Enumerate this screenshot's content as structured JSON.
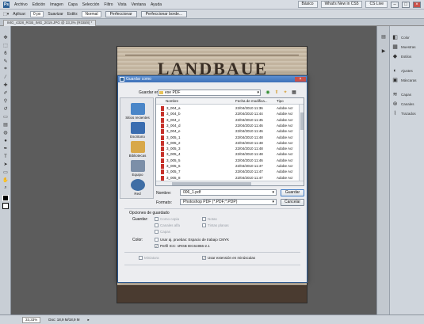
{
  "menubar": {
    "logo": "Ps",
    "items": [
      "Archivo",
      "Edición",
      "Imagen",
      "Capa",
      "Selección",
      "Filtro",
      "Vista",
      "Ventana",
      "Ayuda"
    ],
    "right": {
      "workspace": "Básico",
      "whats_new": "What's New in CS5",
      "cslive": "CS Live"
    }
  },
  "options": {
    "feather_label": "Aplicar:",
    "feather_value": "0 px",
    "antialias_label": "Suavizar",
    "style_label": "Estilo:",
    "style_value": "Normal",
    "refine_label": "Perfeccionar",
    "refine_button": "Perfeccionar borde..."
  },
  "document": {
    "tab_label": "IMG_4328_RGB_IMG_2019.JPG @ 33,3% (RGB/8) *",
    "image_heading": "LANDBAUE"
  },
  "dialog": {
    "title": "Guardar como",
    "save_in_label": "Guardar en:",
    "save_in_value": "ese PDF",
    "places": [
      {
        "label": "Sitios recientes",
        "color": "#4a86c8"
      },
      {
        "label": "Escritorio",
        "color": "#3a6db0"
      },
      {
        "label": "Bibliotecas",
        "color": "#d8a84a"
      },
      {
        "label": "Equipo",
        "color": "#7c8fa8"
      },
      {
        "label": "Red",
        "color": "#3f6ea5"
      }
    ],
    "columns": {
      "name": "Nombre",
      "date": "Fecha de modifica...",
      "type": "Tipo"
    },
    "files": [
      {
        "name": "3_004_a",
        "date": "22/04/2010 11:36",
        "type": "Adobe Acr"
      },
      {
        "name": "3_004_b",
        "date": "22/04/2010 11:44",
        "type": "Adobe Acr"
      },
      {
        "name": "3_004_c",
        "date": "22/04/2010 11:45",
        "type": "Adobe Acr"
      },
      {
        "name": "3_004_d",
        "date": "22/04/2010 11:46",
        "type": "Adobe Acr"
      },
      {
        "name": "3_004_e",
        "date": "22/04/2010 11:46",
        "type": "Adobe Acr"
      },
      {
        "name": "3_005_1",
        "date": "22/04/2010 11:48",
        "type": "Adobe Acr"
      },
      {
        "name": "3_005_2",
        "date": "22/04/2010 11:48",
        "type": "Adobe Acr"
      },
      {
        "name": "3_005_3",
        "date": "22/04/2010 11:48",
        "type": "Adobe Acr"
      },
      {
        "name": "3_005_4",
        "date": "22/04/2010 11:48",
        "type": "Adobe Acr"
      },
      {
        "name": "3_005_5",
        "date": "22/04/2010 11:46",
        "type": "Adobe Acr"
      },
      {
        "name": "3_005_6",
        "date": "22/04/2010 11:47",
        "type": "Adobe Acr"
      },
      {
        "name": "3_005_7",
        "date": "22/04/2010 11:47",
        "type": "Adobe Acr"
      },
      {
        "name": "3_005_8",
        "date": "22/04/2010 11:47",
        "type": "Adobe Acr"
      }
    ],
    "name_label": "Nombre:",
    "name_value": "006_1.pdf",
    "format_label": "Formato:",
    "format_value": "Photoshop PDF (*.PDF;*.PDP)",
    "save_button": "Guardar",
    "cancel_button": "Cancelar",
    "options_heading": "Opciones de guardado",
    "save_label": "Guardar:",
    "opt_copy": "Como copia",
    "opt_notes": "Notas",
    "opt_alpha": "Canales alfa",
    "opt_spot": "Tintas planas",
    "opt_layers": "Capas",
    "color_label": "Color:",
    "opt_proof": "Usar aj. pruebas: Espacio de trabajo CMYK",
    "opt_icc": "Perfil ICC: sRGB IEC61966-2.1",
    "opt_thumb": "Miniatura",
    "opt_ext": "Usar extensión en minúsculas"
  },
  "panels": [
    "Color",
    "Muestras",
    "Estilos",
    "Ajustes",
    "Máscaras",
    "Capas",
    "Canales",
    "Trazados"
  ],
  "status": {
    "zoom": "33,33%",
    "doc": "Doc: 18,9 M/18,9 M"
  }
}
